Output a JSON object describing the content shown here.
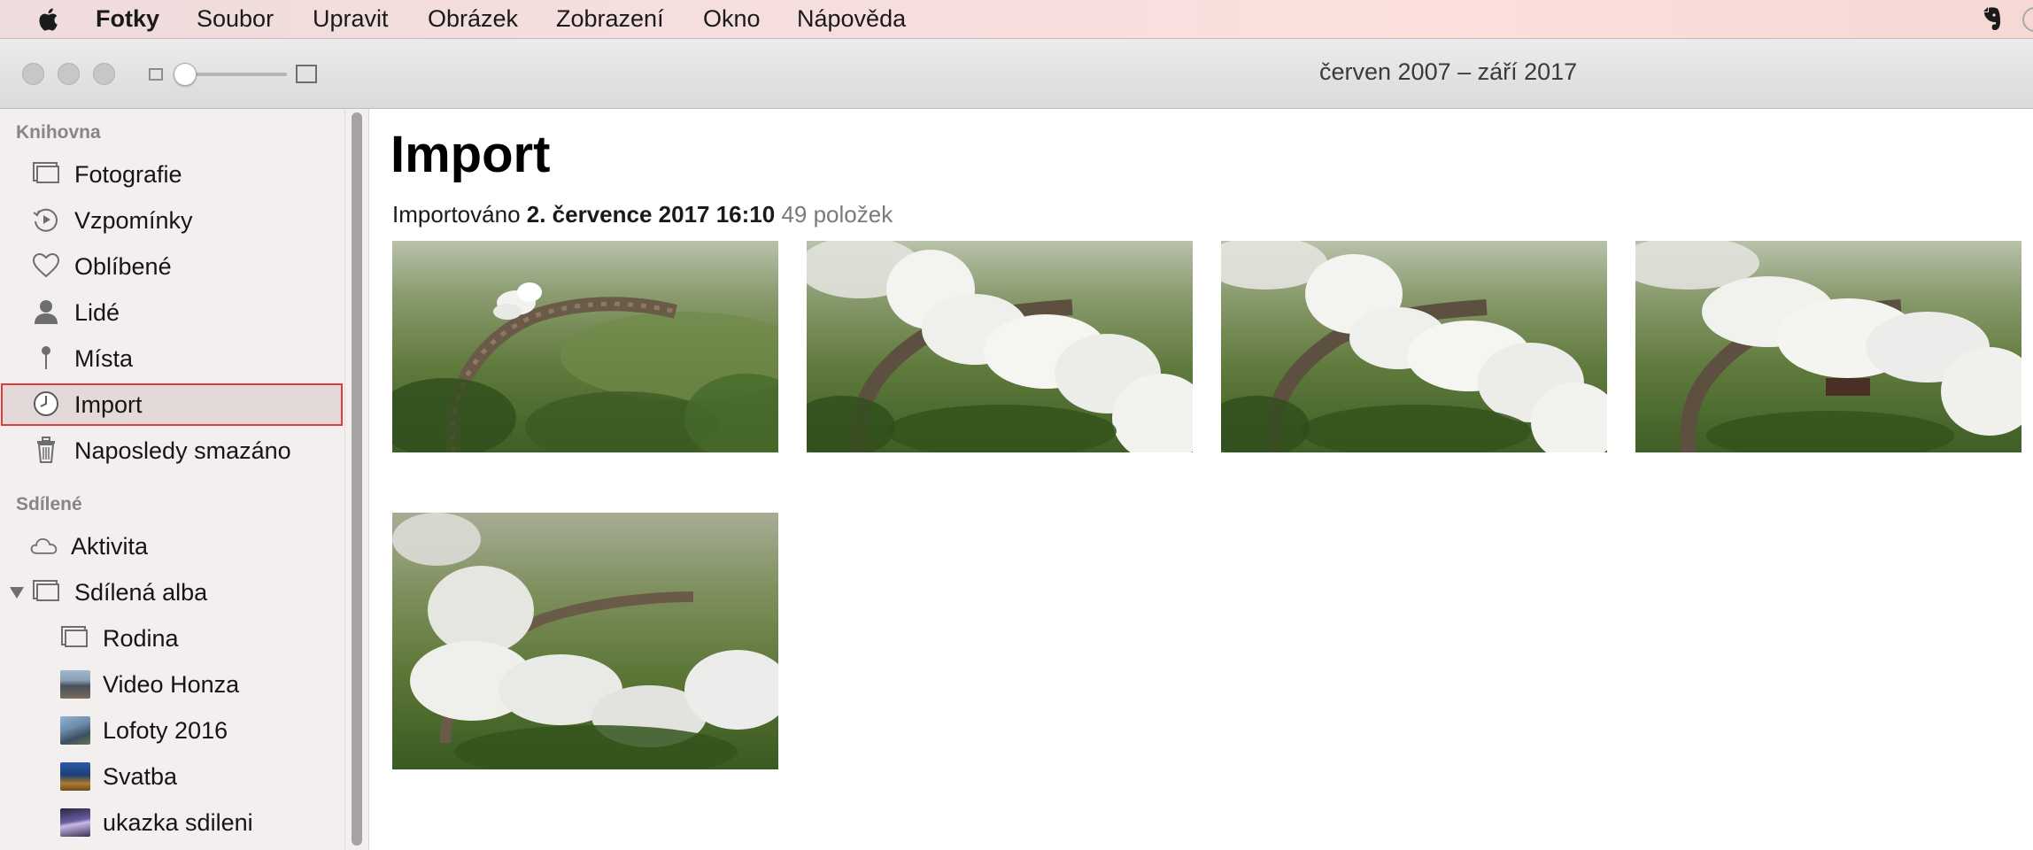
{
  "menubar": {
    "app_name": "Fotky",
    "items": [
      "Soubor",
      "Upravit",
      "Obrázek",
      "Zobrazení",
      "Okno",
      "Nápověda"
    ]
  },
  "window": {
    "title": "červen 2007 – září 2017"
  },
  "sidebar": {
    "library_title": "Knihovna",
    "library_items": [
      {
        "label": "Fotografie",
        "icon": "photos-icon"
      },
      {
        "label": "Vzpomínky",
        "icon": "memories-icon"
      },
      {
        "label": "Oblíbené",
        "icon": "heart-icon"
      },
      {
        "label": "Lidé",
        "icon": "person-icon"
      },
      {
        "label": "Místa",
        "icon": "pin-icon"
      },
      {
        "label": "Import",
        "icon": "clock-icon",
        "selected": true
      },
      {
        "label": "Naposledy smazáno",
        "icon": "trash-icon"
      }
    ],
    "shared_title": "Sdílené",
    "shared_items": [
      {
        "label": "Aktivita",
        "icon": "cloud-icon"
      },
      {
        "label": "Sdílená alba",
        "icon": "albums-icon",
        "expanded": true
      }
    ],
    "albums": [
      {
        "label": "Rodina"
      },
      {
        "label": "Video Honza"
      },
      {
        "label": "Lofoty 2016"
      },
      {
        "label": "Svatba"
      },
      {
        "label": "ukazka sdileni"
      }
    ]
  },
  "main": {
    "title": "Import",
    "import_prefix": "Importováno",
    "import_date": "2. července 2017 16:10",
    "item_count": "49 položek"
  },
  "colors": {
    "selection_outline": "#e03a3a",
    "sidebar_bg": "#f2efee"
  }
}
